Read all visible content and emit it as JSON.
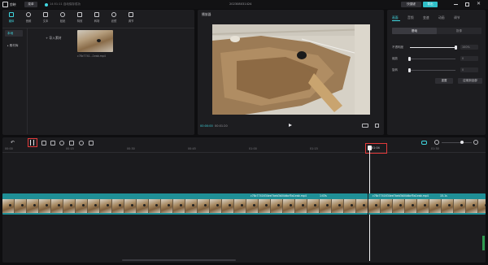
{
  "window": {
    "app_name": "剪映",
    "menu_label": "菜单",
    "autosave_text": "14:51:11 自动保存成功",
    "project_title": "202308031424",
    "shortcut_label": "快捷键",
    "export_label": "导出"
  },
  "toolbar_tabs": [
    {
      "label": "媒体",
      "icon": "media-icon"
    },
    {
      "label": "音频",
      "icon": "audio-icon"
    },
    {
      "label": "文本",
      "icon": "text-icon"
    },
    {
      "label": "贴纸",
      "icon": "sticker-icon"
    },
    {
      "label": "特效",
      "icon": "effects-icon"
    },
    {
      "label": "转场",
      "icon": "transition-icon"
    },
    {
      "label": "滤镜",
      "icon": "filter-icon"
    },
    {
      "label": "调节",
      "icon": "adjust-icon"
    }
  ],
  "media_panel": {
    "sidebar": [
      {
        "label": "本地"
      },
      {
        "label": "素材库"
      }
    ],
    "import_label": "导入素材",
    "clip_name": "c78c7741...1eab.mp4"
  },
  "player": {
    "title": "播放器",
    "current_time": "00:00:00",
    "total_time": "00:01:20"
  },
  "properties": {
    "tabs": [
      {
        "label": "画面"
      },
      {
        "label": "音频"
      },
      {
        "label": "变速"
      },
      {
        "label": "动画"
      },
      {
        "label": "调节"
      }
    ],
    "subtabs": [
      {
        "label": "基础"
      },
      {
        "label": "抠像"
      }
    ],
    "opacity_label": "不透明度",
    "opacity_value": "100%",
    "opacity_fraction": 1.0,
    "zoom_label": "缩放",
    "zoom_value": "0",
    "rotate_label": "旋转",
    "rotate_value": "0",
    "reset_label": "重置",
    "apply_all_label": "应用到全部"
  },
  "timeline": {
    "ruler": [
      {
        "label": "00:00"
      },
      {
        "label": "00:15"
      },
      {
        "label": "00:30"
      },
      {
        "label": "00:45"
      },
      {
        "label": "01:00"
      },
      {
        "label": "01:15"
      },
      {
        "label": "01:30"
      }
    ],
    "playhead_time": "01:04",
    "clip1_label": "c78c7741634ee7beb3b04dbcf5a1eab.mp4",
    "clip1_duration": "1:03s",
    "clip2_label": "c78c7741634ee7beb3b04dbcf5a1eab.mp4",
    "clip2_duration": "15.1s"
  },
  "colors": {
    "accent": "#40d7e0",
    "highlight": "#e23a3a",
    "track_teal": "#1f8f96"
  }
}
